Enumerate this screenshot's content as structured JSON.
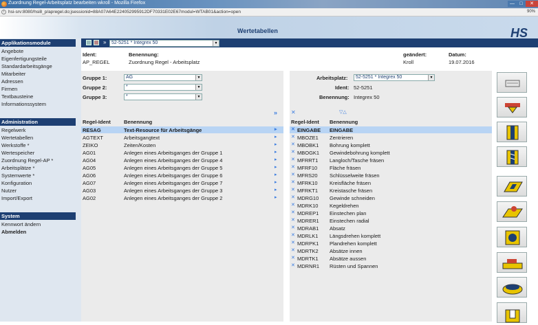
{
  "browser": {
    "title": "Zuordnung Regel-Arbeitsplatz bearbeiten wkroll - Mozilla Firefox",
    "url": "hsi-srv:8080/hsi8_p/apregel.do;jsessionid=88A07A64E224052995912DF70331E02E67modul=WTAB01&action=open",
    "zoom": "90%",
    "win_buttons": [
      "—",
      "□",
      "✕"
    ]
  },
  "header": {
    "title": "Wertetabellen",
    "logo": "HS"
  },
  "sidebar": {
    "section1": "Applikationsmodule",
    "items1": [
      "Angebote",
      "Eigenfertigungsteile",
      "Standardarbeitsgänge",
      "Mitarbeiter",
      "Adressen",
      "Firmen",
      "Textbausteine",
      "Informationssystem"
    ],
    "section2": "Administration",
    "items2": [
      "Regelwerk",
      "Wertetabellen",
      "Werkstoffe *",
      "Wertespeicher",
      "Zuordnung Regel-AP *",
      "Arbeitsplätze *",
      "Systemwerte *",
      "Konfiguration",
      "Nutzer",
      "Import/Export"
    ],
    "section3": "System",
    "items3": [
      "Kennwort ändern",
      "Abmelden"
    ]
  },
  "toolbar": {
    "selector": "52-5251 * Integrex 50"
  },
  "record": {
    "ident_label": "Ident:",
    "ident": "AP_REGEL",
    "benennung_label": "Benennung:",
    "benennung": "Zuordnung Regel - Arbeitsplatz",
    "geaendert_label": "geändert:",
    "geaendert": "Kroll",
    "datum_label": "Datum:",
    "datum": "19.07.2016"
  },
  "filters": {
    "gruppe1_label": "Gruppe 1:",
    "gruppe1": "AG",
    "gruppe2_label": "Gruppe 2:",
    "gruppe2": "*",
    "gruppe3_label": "Gruppe 3:",
    "gruppe3": "*"
  },
  "workplace": {
    "label": "Arbeitsplatz:",
    "value": "52-5251 * Integrex 50",
    "ident_label": "Ident:",
    "ident": "52-5251",
    "benennung_label": "Benennung:",
    "benennung": "Integrex 50"
  },
  "left_table": {
    "headers": [
      "Regel-Ident",
      "Benennung"
    ],
    "rows": [
      [
        "RESAG",
        "Text-Resource für Arbeitsgänge"
      ],
      [
        "AGTEXT",
        "Arbeitsgangtext"
      ],
      [
        "ZEIKO",
        "Zeiten/Kosten"
      ],
      [
        "AG01",
        "Anlegen eines Arbeitsganges der Gruppe 1"
      ],
      [
        "AG04",
        "Anlegen eines Arbeitsganges der Gruppe 4"
      ],
      [
        "AG05",
        "Anlegen eines Arbeitsganges der Gruppe 5"
      ],
      [
        "AG06",
        "Anlegen eines Arbeitsganges der Gruppe 6"
      ],
      [
        "AG07",
        "Anlegen eines Arbeitsganges der Gruppe 7"
      ],
      [
        "AG03",
        "Anlegen eines Arbeitsganges der Gruppe 3"
      ],
      [
        "AG02",
        "Anlegen eines Arbeitsganges der Gruppe 2"
      ]
    ]
  },
  "right_table": {
    "headers": [
      "Regel-Ident",
      "Benennung"
    ],
    "rows": [
      [
        "EINGABE",
        "EINGABE"
      ],
      [
        "MBOZE1",
        "Zentrieren"
      ],
      [
        "MBOBK1",
        "Bohrung komplett"
      ],
      [
        "MBOGK1",
        "Gewindebohrung komplett"
      ],
      [
        "MFRRT1",
        "Langloch/Tasche fräsen"
      ],
      [
        "MFRF10",
        "Fläche fräsen"
      ],
      [
        "MFRS20",
        "Schlüsselweite fräsen"
      ],
      [
        "MFRK10",
        "Kreisfläche fräsen"
      ],
      [
        "MFRKT1",
        "Kreistasche fräsen"
      ],
      [
        "MDRG10",
        "Gewinde schneiden"
      ],
      [
        "MDRK10",
        "Kegeldrehen"
      ],
      [
        "MDREP1",
        "Einstechen plan"
      ],
      [
        "MDRER1",
        "Einstechen radial"
      ],
      [
        "MDRAB1",
        "Absatz"
      ],
      [
        "MDRLK1",
        "Längsdrehen komplett"
      ],
      [
        "MDRPK1",
        "Plandrehen komplett"
      ],
      [
        "MDRTK2",
        "Absätze innen"
      ],
      [
        "MDRTK1",
        "Absätze aussen"
      ],
      [
        "MDRNR1",
        "Rüsten und Spannen"
      ]
    ]
  },
  "icons": {
    "move_all": "»",
    "sort": "▽△",
    "row_arrow": "▸",
    "remove": "✕",
    "tools": [
      "keyboard-icon",
      "chamfer-icon",
      "bore-icon",
      "thread-bore-icon",
      "slot-icon",
      "face-mill-icon",
      "round-pocket-icon",
      "turn-icon",
      "disc-icon",
      "step-icon"
    ]
  }
}
